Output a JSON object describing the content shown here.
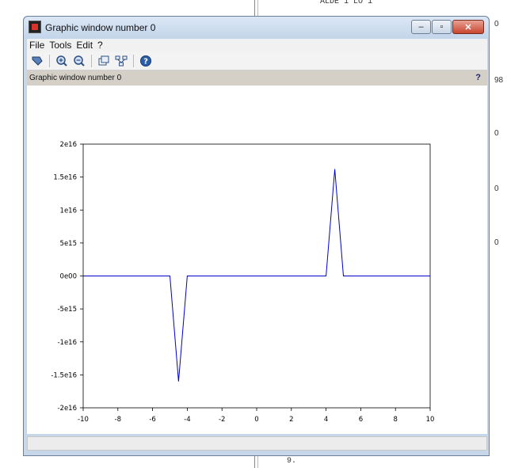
{
  "window": {
    "title": "Graphic window number 0",
    "controls": {
      "minimize": "–",
      "maximize": "▫",
      "close": "✕"
    }
  },
  "menu": [
    "File",
    "Tools",
    "Edit",
    "?"
  ],
  "toolbar": {
    "icons": [
      "rotate-icon",
      "zoom-in-icon",
      "zoom-out-icon",
      "unzoom-icon",
      "datatip-icon",
      "help-icon"
    ]
  },
  "infobar": {
    "text": "Graphic window number 0",
    "help": "?"
  },
  "background": {
    "top_text": "ALDE 1 LO 1",
    "bottom_text": "9.",
    "side_labels": [
      "0",
      "98",
      "0",
      "0",
      "0"
    ]
  },
  "colors": {
    "line": "#0000cc",
    "frame": "#c6d7ea"
  },
  "chart_data": {
    "type": "line",
    "title": "",
    "xlabel": "",
    "ylabel": "",
    "xlim": [
      -10,
      10
    ],
    "ylim": [
      -2e+16,
      2e+16
    ],
    "x_ticks": [
      -10,
      -8,
      -6,
      -4,
      -2,
      0,
      2,
      4,
      6,
      8,
      10
    ],
    "y_ticks": [
      -2e+16,
      -1.5e+16,
      -1e+16,
      -5000000000000000.0,
      0,
      5000000000000000.0,
      1e+16,
      1.5e+16,
      2e+16
    ],
    "x_tick_labels": [
      "-10",
      "-8",
      "-6",
      "-4",
      "-2",
      "0",
      "2",
      "4",
      "6",
      "8",
      "10"
    ],
    "y_tick_labels": [
      "-2e16",
      "-1.5e16",
      "-1e16",
      "-5e15",
      "0e00",
      "5e15",
      "1e16",
      "1.5e16",
      "2e16"
    ],
    "grid": false,
    "series": [
      {
        "x": [
          -10,
          -5,
          -4.5,
          -4,
          4,
          4.5,
          5,
          10
        ],
        "y": [
          0,
          0,
          -1.6e+16,
          0,
          0,
          1.62e+16,
          0,
          0
        ]
      }
    ]
  }
}
